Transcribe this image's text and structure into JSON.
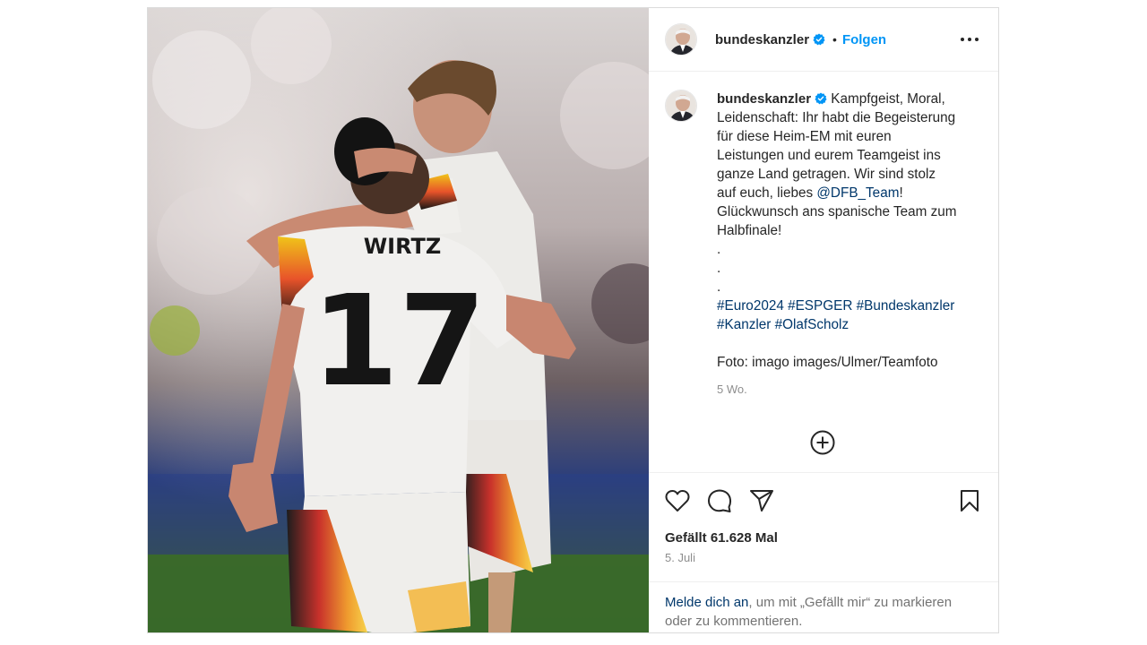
{
  "post": {
    "username": "bundeskanzler",
    "follow_label": "Folgen",
    "separator": "•",
    "more_icon": "more-horizontal-icon",
    "verified_icon": "verified-badge-icon",
    "caption": {
      "first_line": "Kampfgeist, Moral,",
      "lines": [
        "Leidenschaft: Ihr habt die Begeisterung",
        "für diese Heim-EM mit euren",
        "Leistungen und eurem Teamgeist ins",
        "ganze Land getragen. Wir sind stolz"
      ],
      "mention_prefix": "auf euch, liebes ",
      "mention": "@DFB_Team",
      "mention_suffix": "!",
      "lines2": [
        "Glückwunsch ans spanische Team zum",
        "Halbfinale!",
        ".",
        ".",
        "."
      ],
      "hashtags_line1": "#Euro2024 #ESPGER #Bundeskanzler",
      "hashtags_line2": "#Kanzler #OlafScholz",
      "credit": "Foto: imago images/Ulmer/Teamfoto"
    },
    "age": "5 Wo.",
    "likes": "Gefällt 61.628 Mal",
    "date": "5. Juli",
    "login_link": "Melde dich an",
    "login_text": ", um mit „Gefällt mir“ zu markieren oder zu kommentieren.",
    "photo": {
      "jersey_name": "WIRTZ",
      "jersey_number": "17"
    },
    "colors": {
      "link": "#00376b",
      "follow": "#0095f6",
      "verified": "#0095f6",
      "muted": "#8e8e8e"
    }
  }
}
